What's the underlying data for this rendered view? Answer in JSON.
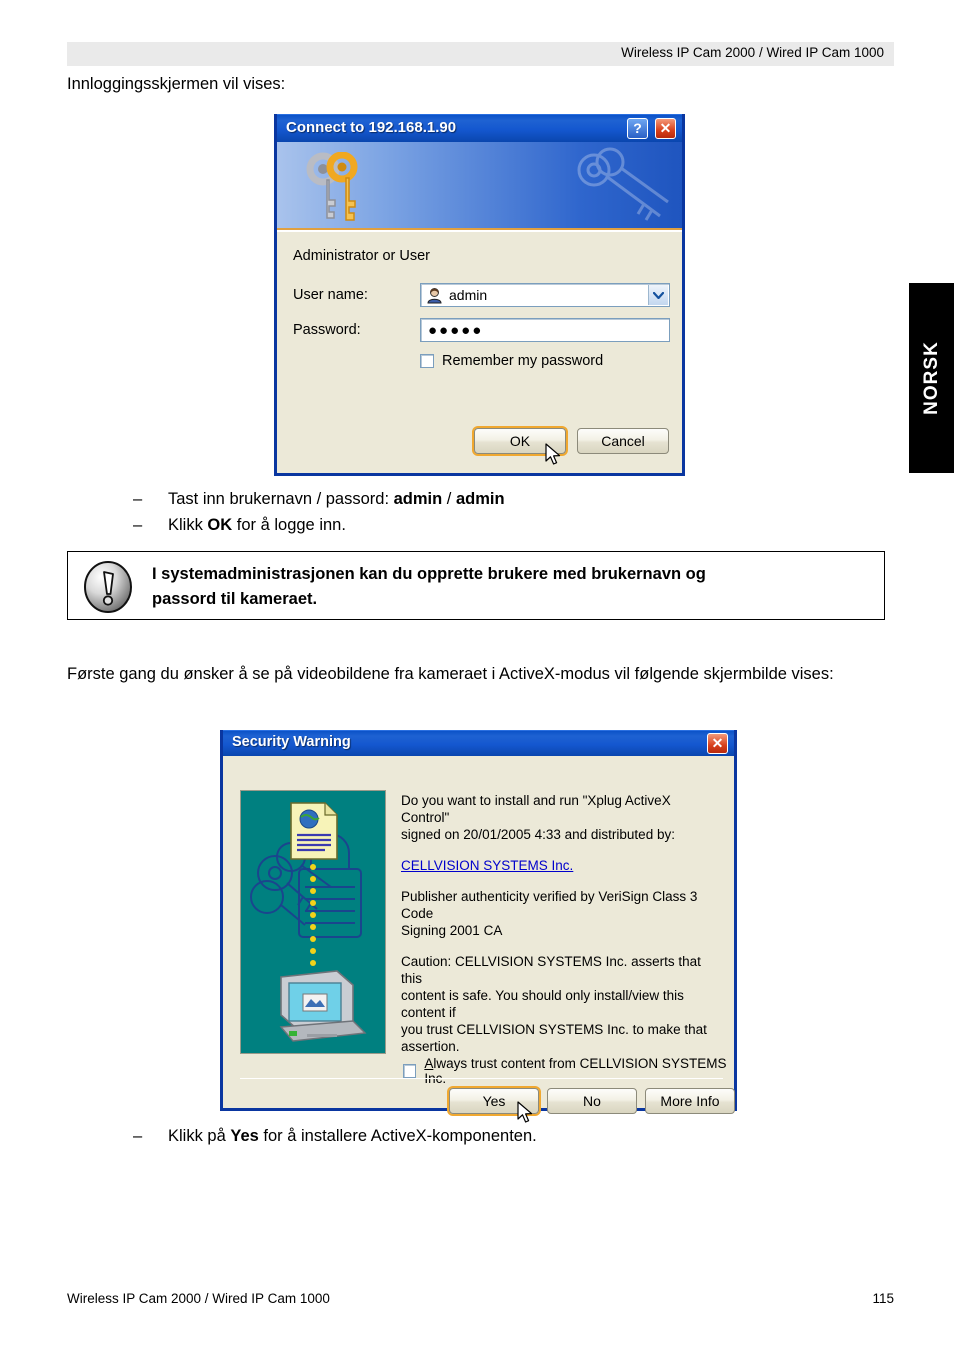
{
  "page": {
    "header_text": "Wireless IP Cam 2000 / Wired IP Cam 1000",
    "side_tab": "NORSK",
    "footer_left": "Wireless IP Cam 2000 / Wired IP Cam 1000",
    "footer_page": "115",
    "intro": "Innloggingsskjermen vil vises:",
    "paragraph2": "Første gang du ønsker å se på videobildene fra kameraet i ActiveX-modus vil følgende skjermbilde vises:"
  },
  "bullets_login": [
    {
      "dash": "–",
      "before": "Tast inn brukernavn / passord: ",
      "bold": "admin",
      "middle": " / ",
      "bold2": "admin",
      "after": ""
    },
    {
      "dash": "–",
      "before": "Klikk ",
      "bold": "OK",
      "middle": " for å logge inn.",
      "bold2": "",
      "after": ""
    }
  ],
  "bullets_activex": [
    {
      "dash": "–",
      "before": "Klikk på ",
      "bold": "Yes",
      "middle": " for å installere ActiveX-komponenten.",
      "bold2": "",
      "after": ""
    }
  ],
  "note": {
    "icon": "exclamation-icon",
    "line1": "I systemadministrasjonen kan du opprette brukere med brukernavn og",
    "line2": "passord til kameraet."
  },
  "login_dialog": {
    "title": "Connect to 192.168.1.90",
    "help_button": "?",
    "close_button": "✕",
    "realm_label": "Administrator or User",
    "username_label": "User name:",
    "username_value": "admin",
    "password_label": "Password:",
    "password_value": "●●●●●",
    "remember_label": "Remember my password",
    "remember_checked": false,
    "ok_label": "OK",
    "cancel_label": "Cancel",
    "titlebar_color": "#1e62d2",
    "face_color": "#ece9d8",
    "focus_color": "#f0a830"
  },
  "security_dialog": {
    "title": "Security Warning",
    "close_button": "✕",
    "question_line1": "Do you want to install and run \"Xplug ActiveX Control\"",
    "question_line2": "signed on 20/01/2005 4:33 and distributed by:",
    "publisher_link": "CELLVISION SYSTEMS Inc.",
    "verified_line1": "Publisher authenticity verified by VeriSign Class 3 Code",
    "verified_line2": "Signing 2001 CA",
    "caution_line1": "Caution: CELLVISION SYSTEMS Inc. asserts that this",
    "caution_line2": "content is safe.  You should only install/view this content if",
    "caution_line3": "you trust CELLVISION SYSTEMS Inc. to make that",
    "caution_line4": "assertion.",
    "always_trust_accel": "A",
    "always_trust_rest": "lways trust content from CELLVISION SYSTEMS Inc.",
    "always_trust_checked": false,
    "yes_label": "Yes",
    "no_label": "No",
    "more_info_label": "More Info",
    "image_bg_color": "#008080",
    "link_color": "#0000cc"
  }
}
